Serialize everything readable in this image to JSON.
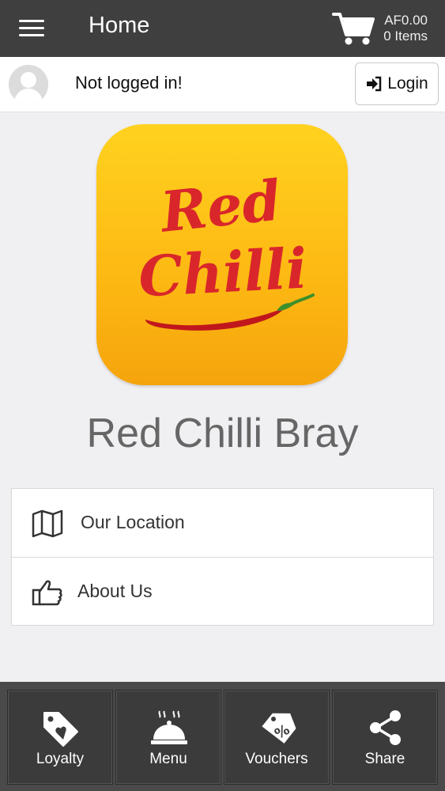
{
  "header": {
    "title": "Home",
    "cart_amount": "AF0.00",
    "cart_items": "0 Items"
  },
  "user": {
    "status": "Not logged in!",
    "login_label": "Login"
  },
  "brand": {
    "logo_line1": "Red",
    "logo_line2": "Chilli",
    "name": "Red Chilli Bray",
    "logo_color": "#fdb813",
    "logo_text_color": "#d9262b"
  },
  "menu": {
    "items": [
      {
        "label": "Our Location",
        "icon": "map-icon"
      },
      {
        "label": "About Us",
        "icon": "thumbs-up-icon"
      }
    ]
  },
  "nav": {
    "tabs": [
      {
        "label": "Loyalty",
        "icon": "heart-tag-icon"
      },
      {
        "label": "Menu",
        "icon": "cloche-icon"
      },
      {
        "label": "Vouchers",
        "icon": "discount-tag-icon"
      },
      {
        "label": "Share",
        "icon": "share-icon"
      }
    ]
  },
  "colors": {
    "topbar": "#3f3f3f",
    "bottombar": "#4a4a4a",
    "background": "#f0eff1"
  }
}
